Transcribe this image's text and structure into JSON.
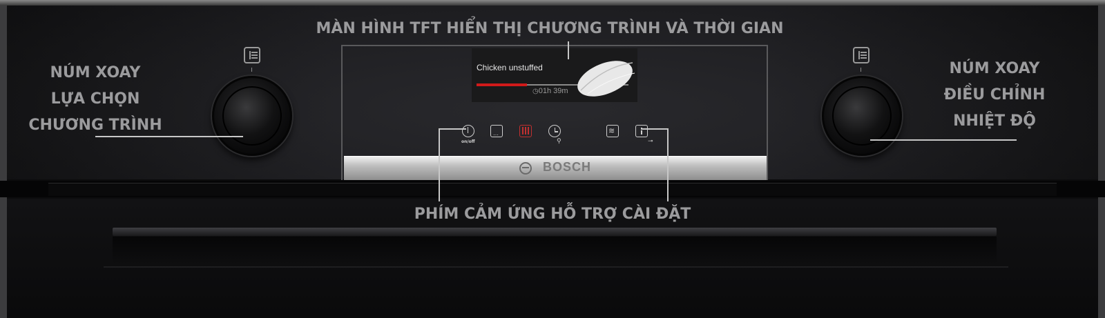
{
  "annotations": {
    "display_label": "MÀN HÌNH TFT HIỂN THỊ CHƯƠNG TRÌNH VÀ THỜI GIAN",
    "left_knob_lines": [
      "NÚM XOAY",
      "LỰA CHỌN",
      "CHƯƠNG TRÌNH"
    ],
    "right_knob_lines": [
      "NÚM XOAY",
      "ĐIỀU CHỈNH",
      "NHIỆT ĐỘ"
    ],
    "touch_keys_label": "PHÍM CẢM ỨNG HỖ TRỢ CÀI ĐẶT"
  },
  "tft": {
    "program_name": "Chicken unstuffed",
    "remaining_time": "01h 39m",
    "progress_fraction": 0.33,
    "progress_color": "#d01a1a"
  },
  "touch_keys": {
    "power_label": "on/off"
  },
  "brand": {
    "name": "BOSCH"
  },
  "colors": {
    "annotation_text": "#9b9b9d",
    "panel": "#1c1c1f",
    "accent_red": "#d01a1a"
  }
}
